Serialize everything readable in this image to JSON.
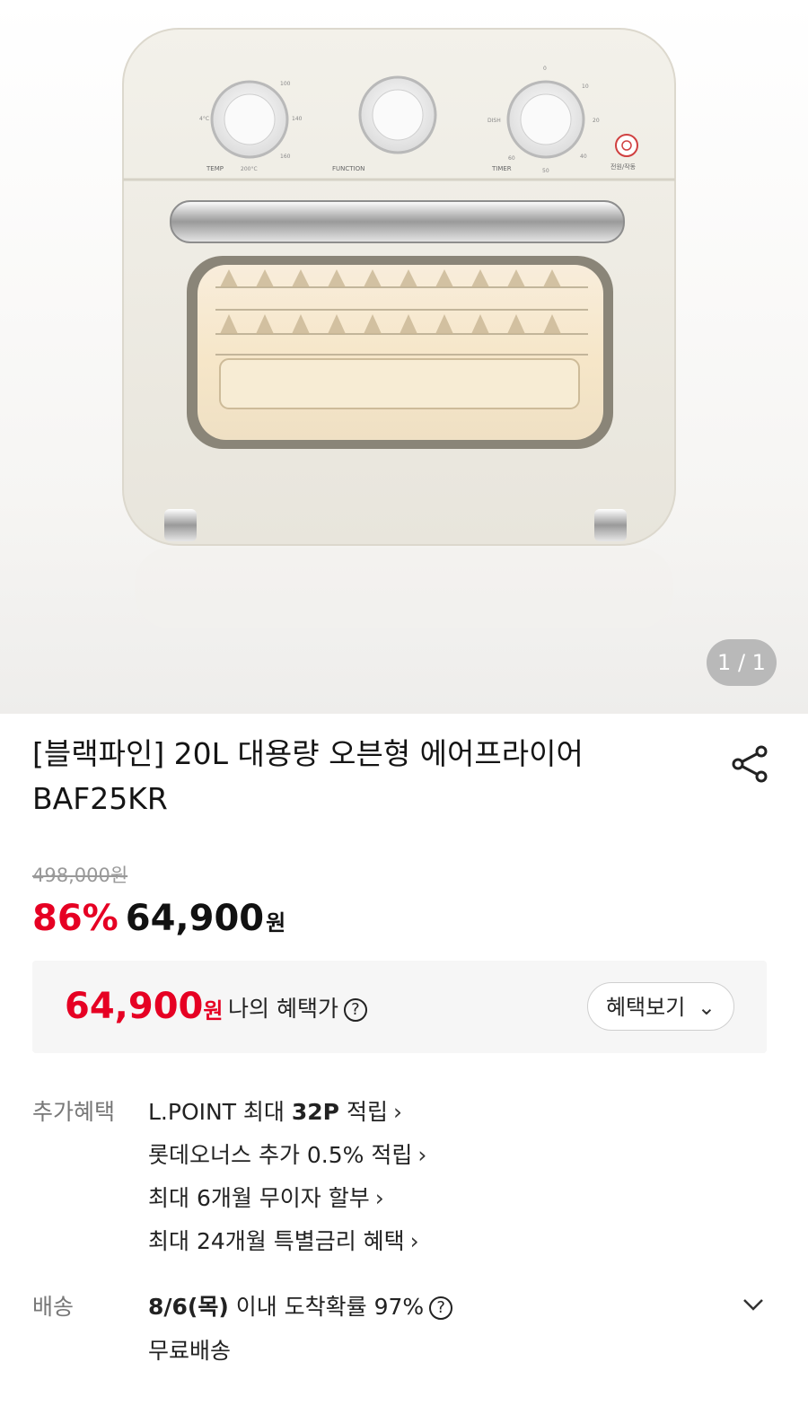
{
  "gallery": {
    "pager": "1 / 1"
  },
  "oven_labels": {
    "temp": "TEMP",
    "function": "FUNCTION",
    "timer": "TIMER",
    "power": "전원/작동",
    "temp_scale": [
      "100",
      "140",
      "4°C",
      "160",
      "200°C"
    ],
    "timer_scale": [
      "0",
      "10",
      "20",
      "DISH",
      "40",
      "50",
      "60"
    ]
  },
  "product": {
    "title_line1": "[블랙파인] 20L 대용량 오븐형 에어프라이어",
    "title_line2": "BAF25KR",
    "share_icon": "share-icon",
    "original_price": "498,000원",
    "discount_rate": "86%",
    "sale_price": "64,900",
    "currency": "원"
  },
  "benefit": {
    "price": "64,900",
    "currency": "원",
    "label": "나의 혜택가",
    "help_glyph": "?",
    "button_label": "혜택보기",
    "button_chevron": "⌄"
  },
  "extra_benefits": {
    "label": "추가혜택",
    "items": [
      {
        "prefix": "L.POINT 최대 ",
        "bold": "32P",
        "suffix": " 적립",
        "chevron": "›"
      },
      {
        "prefix": "롯데오너스 추가 0.5% 적립",
        "bold": "",
        "suffix": "",
        "chevron": "›"
      },
      {
        "prefix": "최대 6개월 무이자 할부",
        "bold": "",
        "suffix": "",
        "chevron": "›"
      },
      {
        "prefix": "최대 24개월 특별금리 혜택",
        "bold": "",
        "suffix": "",
        "chevron": "›"
      }
    ]
  },
  "shipping": {
    "label": "배송",
    "date": "8/6(목)",
    "text": " 이내 도착확률 97%",
    "help_glyph": "?",
    "fee": "무료배송"
  },
  "colors": {
    "accent": "#e60023",
    "oven_body": "#efece3"
  }
}
